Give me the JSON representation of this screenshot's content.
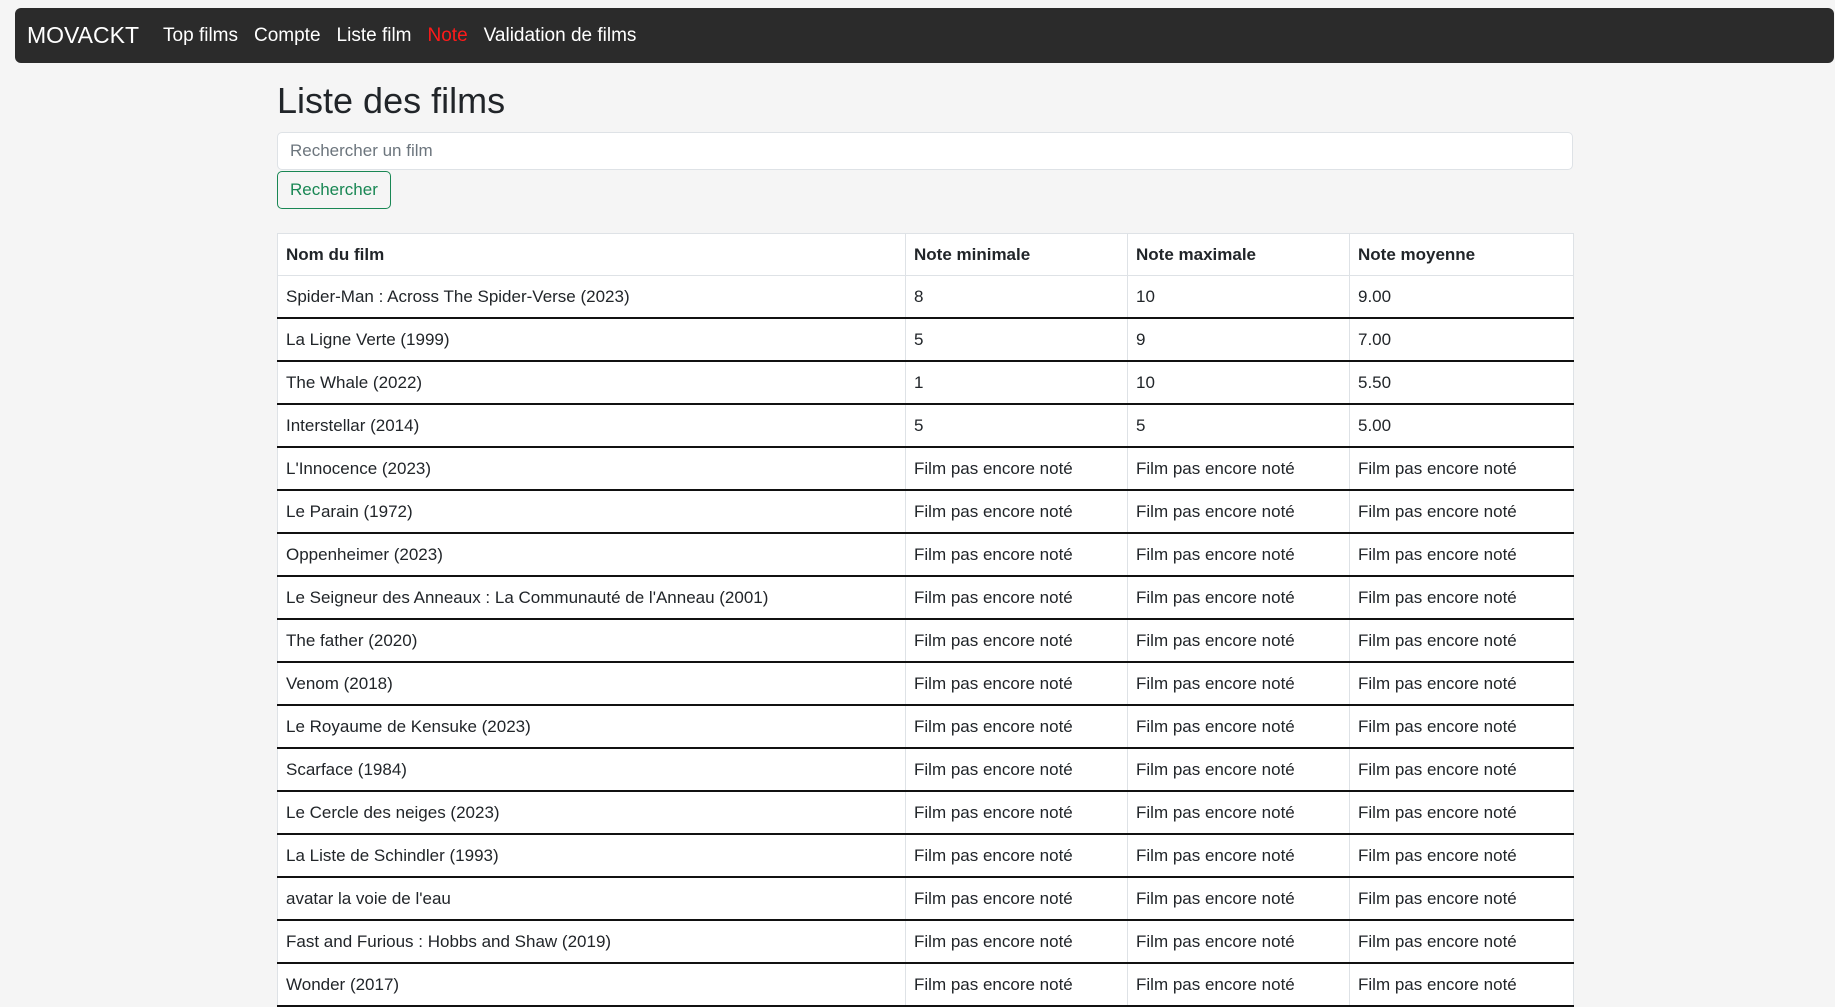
{
  "navbar": {
    "brand": "MOVACKT",
    "links": [
      {
        "label": "Top films",
        "active": false
      },
      {
        "label": "Compte",
        "active": false
      },
      {
        "label": "Liste film",
        "active": false
      },
      {
        "label": "Note",
        "active": true
      },
      {
        "label": "Validation de films",
        "active": false
      }
    ],
    "active_color": "#ff1a1a",
    "background_color": "#2b2b2b"
  },
  "page": {
    "title": "Liste des films"
  },
  "search": {
    "placeholder": "Rechercher un film",
    "value": "",
    "button_label": "Rechercher",
    "button_color": "#198754"
  },
  "table": {
    "columns": [
      "Nom du film",
      "Note minimale",
      "Note maximale",
      "Note moyenne"
    ],
    "rows": [
      [
        "Spider-Man : Across The Spider-Verse (2023)",
        "8",
        "10",
        "9.00"
      ],
      [
        "La Ligne Verte (1999)",
        "5",
        "9",
        "7.00"
      ],
      [
        "The Whale (2022)",
        "1",
        "10",
        "5.50"
      ],
      [
        "Interstellar (2014)",
        "5",
        "5",
        "5.00"
      ],
      [
        "L'Innocence (2023)",
        "Film pas encore noté",
        "Film pas encore noté",
        "Film pas encore noté"
      ],
      [
        "Le Parain (1972)",
        "Film pas encore noté",
        "Film pas encore noté",
        "Film pas encore noté"
      ],
      [
        "Oppenheimer (2023)",
        "Film pas encore noté",
        "Film pas encore noté",
        "Film pas encore noté"
      ],
      [
        "Le Seigneur des Anneaux : La Communauté de l'Anneau (2001)",
        "Film pas encore noté",
        "Film pas encore noté",
        "Film pas encore noté"
      ],
      [
        "The father (2020)",
        "Film pas encore noté",
        "Film pas encore noté",
        "Film pas encore noté"
      ],
      [
        "Venom (2018)",
        "Film pas encore noté",
        "Film pas encore noté",
        "Film pas encore noté"
      ],
      [
        "Le Royaume de Kensuke (2023)",
        "Film pas encore noté",
        "Film pas encore noté",
        "Film pas encore noté"
      ],
      [
        "Scarface (1984)",
        "Film pas encore noté",
        "Film pas encore noté",
        "Film pas encore noté"
      ],
      [
        "Le Cercle des neiges (2023)",
        "Film pas encore noté",
        "Film pas encore noté",
        "Film pas encore noté"
      ],
      [
        "La Liste de Schindler (1993)",
        "Film pas encore noté",
        "Film pas encore noté",
        "Film pas encore noté"
      ],
      [
        "avatar la voie de l'eau",
        "Film pas encore noté",
        "Film pas encore noté",
        "Film pas encore noté"
      ],
      [
        "Fast and Furious : Hobbs and Shaw (2019)",
        "Film pas encore noté",
        "Film pas encore noté",
        "Film pas encore noté"
      ],
      [
        "Wonder (2017)",
        "Film pas encore noté",
        "Film pas encore noté",
        "Film pas encore noté"
      ]
    ]
  }
}
